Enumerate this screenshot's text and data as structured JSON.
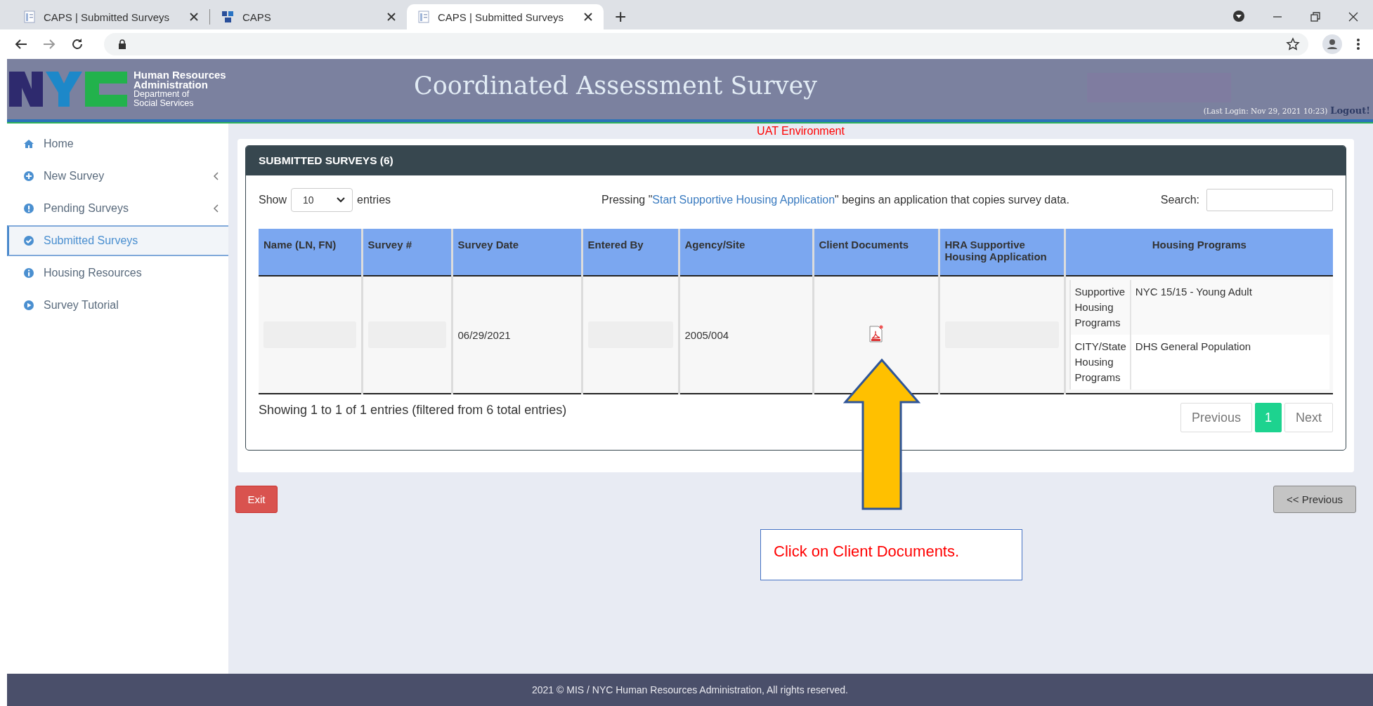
{
  "browser": {
    "tabs": [
      {
        "title": "CAPS | Submitted Surveys",
        "kind": "page",
        "selected": false
      },
      {
        "title": "CAPS",
        "kind": "logo",
        "selected": false
      },
      {
        "title": "CAPS | Submitted Surveys",
        "kind": "page",
        "selected": true
      }
    ],
    "new_tab": "+"
  },
  "header": {
    "org_lines": [
      "Human Resources",
      "Administration",
      "Department of",
      "Social Services"
    ],
    "title": "Coordinated Assessment Survey",
    "last_login": "(Last Login: Nov 29, 2021 10:23)",
    "logout": "Logout!"
  },
  "environment": "UAT Environment",
  "sidebar": {
    "items": [
      {
        "label": "Home",
        "kind": "home",
        "expandable": false,
        "selected": false
      },
      {
        "label": "New Survey",
        "kind": "plus",
        "expandable": true,
        "selected": false
      },
      {
        "label": "Pending Surveys",
        "kind": "exclaim",
        "expandable": true,
        "selected": false
      },
      {
        "label": "Submitted Surveys",
        "kind": "check",
        "expandable": false,
        "selected": true
      },
      {
        "label": "Housing Resources",
        "kind": "info",
        "expandable": false,
        "selected": false
      },
      {
        "label": "Survey Tutorial",
        "kind": "play",
        "expandable": false,
        "selected": false
      }
    ]
  },
  "panel": {
    "title": "SUBMITTED SURVEYS (6)",
    "length": {
      "before": "Show",
      "value": "10",
      "after": "entries"
    },
    "notice": {
      "before": "Pressing \"",
      "link": "Start Supportive Housing Application",
      "after": "\" begins an application that copies survey data."
    },
    "search": {
      "label": "Search:"
    },
    "table": {
      "columns": [
        "Name (LN, FN)",
        "Survey #",
        "Survey Date",
        "Entered By",
        "Agency/Site",
        "Client Documents",
        "HRA Supportive Housing Application",
        "Housing Programs"
      ],
      "rows": [
        {
          "cells": [
            {
              "kind": "redacted"
            },
            {
              "kind": "redacted"
            },
            {
              "kind": "text",
              "text": "06/29/2021"
            },
            {
              "kind": "redacted"
            },
            {
              "kind": "text",
              "text": "2005/004"
            },
            {
              "kind": "document"
            },
            {
              "kind": "redacted"
            },
            {
              "kind": "programs",
              "programs": [
                {
                  "category": "Supportive Housing Programs",
                  "program": "NYC 15/15 - Young Adult"
                },
                {
                  "category": "CITY/State Housing Programs",
                  "program": "DHS General Population"
                }
              ]
            }
          ]
        }
      ]
    },
    "info": "Showing 1 to 1 of 1 entries (filtered from 6 total entries)",
    "pagination": [
      {
        "label": "Previous",
        "selected": false
      },
      {
        "label": "1",
        "selected": true
      },
      {
        "label": "Next",
        "selected": false
      }
    ]
  },
  "buttons": {
    "exit": "Exit",
    "previous": "<< Previous"
  },
  "callout": "Click on Client Documents.",
  "footer": "2021 © MIS / NYC Human Resources Administration, All rights reserved."
}
